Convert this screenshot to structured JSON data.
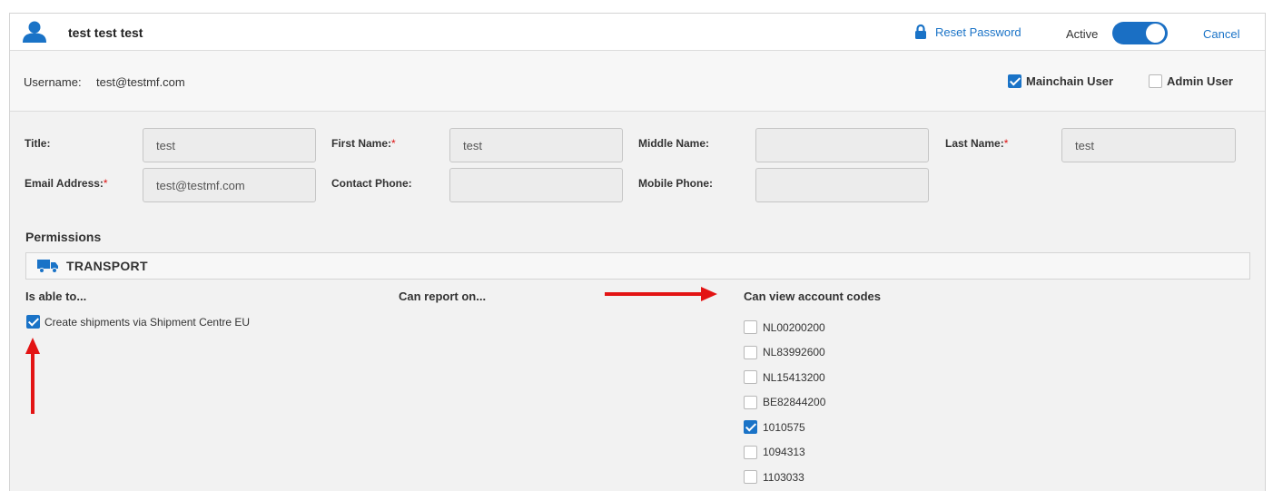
{
  "header": {
    "title": "test test test",
    "reset_password": "Reset Password",
    "active_label": "Active",
    "active_on": true,
    "cancel": "Cancel",
    "accent_color": "#1a73c7"
  },
  "subheader": {
    "username_label": "Username:",
    "username_value": "test@testmf.com",
    "mainchain_label": "Mainchain User",
    "mainchain_checked": true,
    "admin_label": "Admin User",
    "admin_checked": false
  },
  "form": {
    "title_label": "Title:",
    "title_value": "test",
    "first_name_label": "First Name:",
    "first_name_value": "test",
    "middle_name_label": "Middle Name:",
    "middle_name_value": "",
    "last_name_label": "Last Name:",
    "last_name_value": "test",
    "email_label": "Email Address:",
    "email_value": "test@testmf.com",
    "contact_phone_label": "Contact Phone:",
    "contact_phone_value": "",
    "mobile_phone_label": "Mobile Phone:",
    "mobile_phone_value": "",
    "required_marker": "*"
  },
  "permissions": {
    "title": "Permissions",
    "section": "TRANSPORT",
    "col_able": "Is able to...",
    "col_report": "Can report on...",
    "col_codes": "Can view account codes",
    "abilities": [
      {
        "label": "Create shipments via Shipment Centre EU",
        "checked": true
      }
    ],
    "account_codes": [
      {
        "code": "NL00200200",
        "checked": false
      },
      {
        "code": "NL83992600",
        "checked": false
      },
      {
        "code": "NL15413200",
        "checked": false
      },
      {
        "code": "BE82844200",
        "checked": false
      },
      {
        "code": "1010575",
        "checked": true
      },
      {
        "code": "1094313",
        "checked": false
      },
      {
        "code": "1103033",
        "checked": false
      }
    ]
  },
  "annotation_color": "#e31414"
}
